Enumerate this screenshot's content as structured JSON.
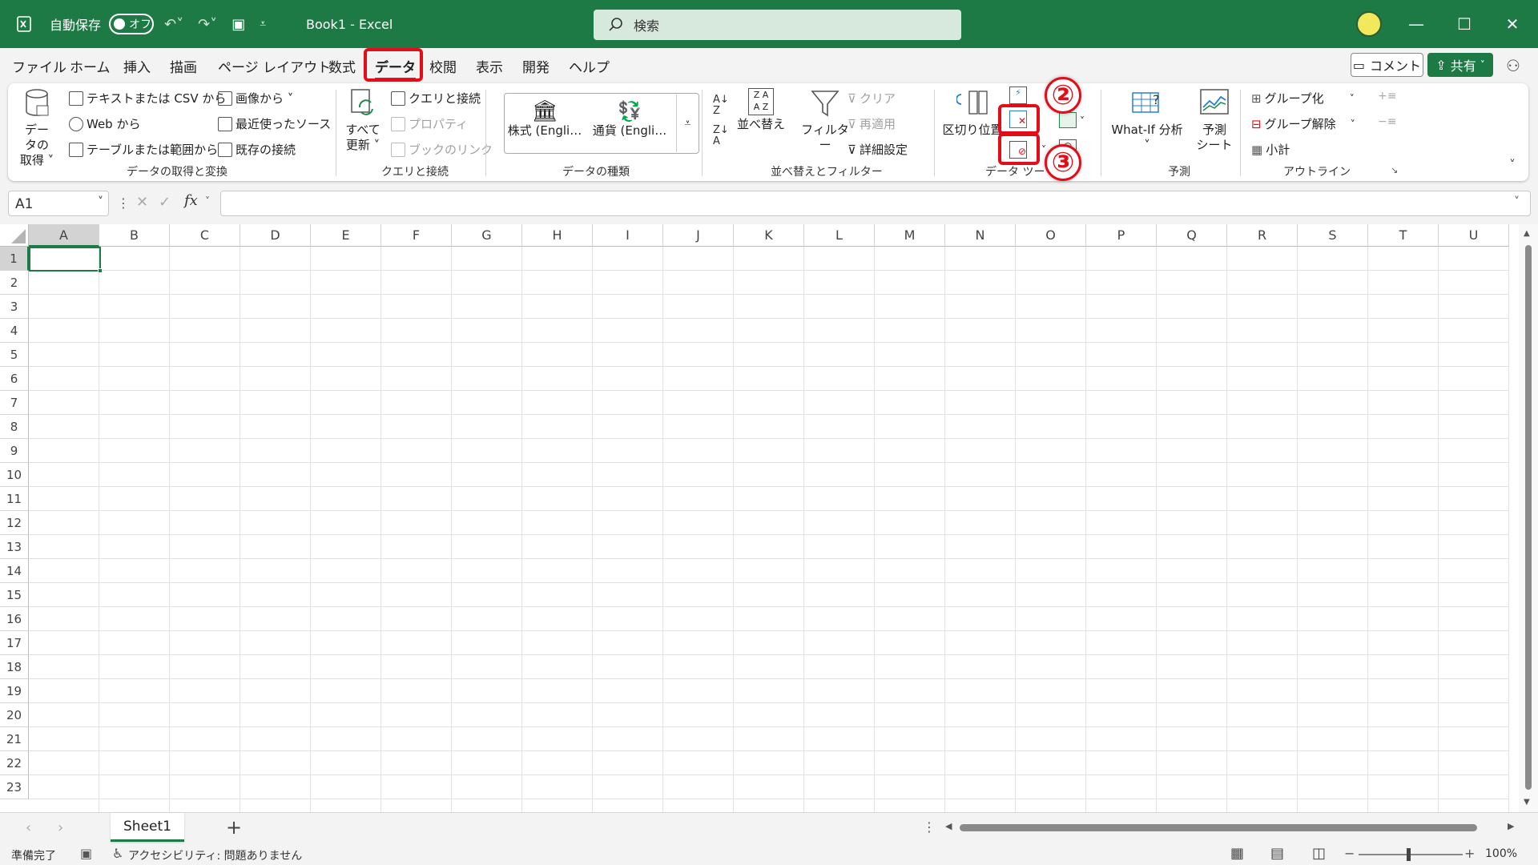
{
  "titlebar": {
    "autosave_label": "自動保存",
    "autosave_state": "オフ",
    "doc_title": "Book1  -  Excel",
    "search_placeholder": "検索"
  },
  "menu": {
    "tabs": [
      "ファイル",
      "ホーム",
      "挿入",
      "描画",
      "ページ レイアウト",
      "数式",
      "データ",
      "校閲",
      "表示",
      "開発",
      "ヘルプ"
    ],
    "active_tab": "データ",
    "comment_label": "コメント",
    "share_label": "共有"
  },
  "ribbon": {
    "get_data": {
      "big_label_1": "データの",
      "big_label_2": "取得 ˅",
      "items": [
        "テキストまたは CSV から",
        "Web から",
        "テーブルまたは範囲から",
        "画像から ˅",
        "最近使ったソース",
        "既存の接続"
      ],
      "group_label": "データの取得と変換"
    },
    "queries": {
      "big_label_1": "すべて",
      "big_label_2": "更新 ˅",
      "items": [
        "クエリと接続",
        "プロパティ",
        "ブックのリンク"
      ],
      "group_label": "クエリと接続"
    },
    "data_types": {
      "items": [
        "株式 (Engli…",
        "通貨 (Engli…"
      ],
      "group_label": "データの種類"
    },
    "sort_filter": {
      "sort_label": "並べ替え",
      "filter_label": "フィルター",
      "items": [
        "クリア",
        "再適用",
        "詳細設定"
      ],
      "group_label": "並べ替えとフィルター"
    },
    "data_tools": {
      "text_to_columns": "区切り位置",
      "group_label": "データ ツー",
      "callout_2": "②",
      "callout_3": "③"
    },
    "forecast": {
      "whatif_label": "What-If 分析",
      "whatif_caret": "˅",
      "sheet_label_1": "予測",
      "sheet_label_2": "シート",
      "group_label": "予測"
    },
    "outline": {
      "items": [
        "グループ化",
        "グループ解除",
        "小計"
      ],
      "group_label": "アウトライン"
    }
  },
  "formula_bar": {
    "name_box": "A1",
    "fx": "fx"
  },
  "grid": {
    "columns": [
      "A",
      "B",
      "C",
      "D",
      "E",
      "F",
      "G",
      "H",
      "I",
      "J",
      "K",
      "L",
      "M",
      "N",
      "O",
      "P",
      "Q",
      "R",
      "S",
      "T",
      "U"
    ],
    "rows": [
      "1",
      "2",
      "3",
      "4",
      "5",
      "6",
      "7",
      "8",
      "9",
      "10",
      "11",
      "12",
      "13",
      "14",
      "15",
      "16",
      "17",
      "18",
      "19",
      "20",
      "21",
      "22",
      "23"
    ],
    "selected_cell": "A1"
  },
  "sheets": {
    "tabs": [
      "Sheet1"
    ],
    "add_label": "+"
  },
  "status": {
    "ready": "準備完了",
    "accessibility": "アクセシビリティ: 問題ありません",
    "zoom": "100%"
  },
  "colors": {
    "accent": "#1e7a45",
    "callout": "#e20d19"
  }
}
